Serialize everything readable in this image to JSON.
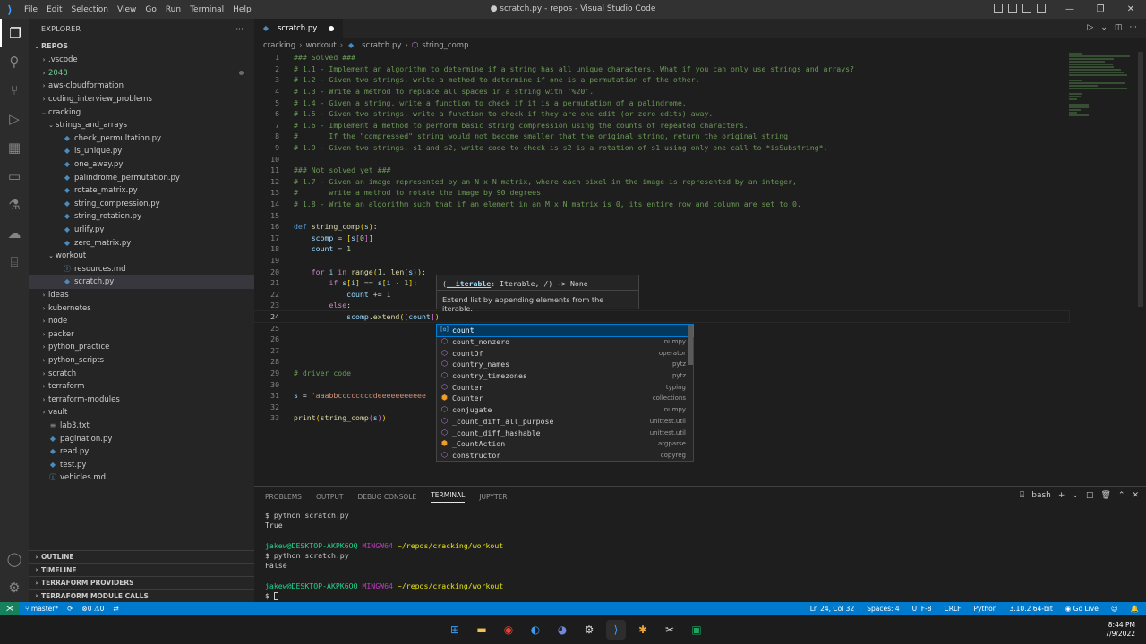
{
  "window": {
    "title": "● scratch.py - repos - Visual Studio Code",
    "menu": [
      "File",
      "Edit",
      "Selection",
      "View",
      "Go",
      "Run",
      "Terminal",
      "Help"
    ]
  },
  "sidebar": {
    "header": "EXPLORER",
    "header_more": "···",
    "root": "REPOS",
    "tree": [
      {
        "label": ".vscode",
        "depth": 1,
        "type": "folder",
        "open": false
      },
      {
        "label": "2048",
        "depth": 1,
        "type": "folder",
        "open": false,
        "color": "#73c991",
        "modified": true
      },
      {
        "label": "aws-cloudformation",
        "depth": 1,
        "type": "folder",
        "open": false
      },
      {
        "label": "coding_interview_problems",
        "depth": 1,
        "type": "folder",
        "open": false
      },
      {
        "label": "cracking",
        "depth": 1,
        "type": "folder",
        "open": true
      },
      {
        "label": "strings_and_arrays",
        "depth": 2,
        "type": "folder",
        "open": true
      },
      {
        "label": "check_permultation.py",
        "depth": 3,
        "type": "py"
      },
      {
        "label": "is_unique.py",
        "depth": 3,
        "type": "py"
      },
      {
        "label": "one_away.py",
        "depth": 3,
        "type": "py"
      },
      {
        "label": "palindrome_permutation.py",
        "depth": 3,
        "type": "py"
      },
      {
        "label": "rotate_matrix.py",
        "depth": 3,
        "type": "py"
      },
      {
        "label": "string_compression.py",
        "depth": 3,
        "type": "py"
      },
      {
        "label": "string_rotation.py",
        "depth": 3,
        "type": "py"
      },
      {
        "label": "urlify.py",
        "depth": 3,
        "type": "py"
      },
      {
        "label": "zero_matrix.py",
        "depth": 3,
        "type": "py"
      },
      {
        "label": "workout",
        "depth": 2,
        "type": "folder",
        "open": true
      },
      {
        "label": "resources.md",
        "depth": 3,
        "type": "md"
      },
      {
        "label": "scratch.py",
        "depth": 3,
        "type": "py",
        "selected": true
      },
      {
        "label": "ideas",
        "depth": 1,
        "type": "folder",
        "open": false
      },
      {
        "label": "kubernetes",
        "depth": 1,
        "type": "folder",
        "open": false
      },
      {
        "label": "node",
        "depth": 1,
        "type": "folder",
        "open": false
      },
      {
        "label": "packer",
        "depth": 1,
        "type": "folder",
        "open": false
      },
      {
        "label": "python_practice",
        "depth": 1,
        "type": "folder",
        "open": false
      },
      {
        "label": "python_scripts",
        "depth": 1,
        "type": "folder",
        "open": false
      },
      {
        "label": "scratch",
        "depth": 1,
        "type": "folder",
        "open": false
      },
      {
        "label": "terraform",
        "depth": 1,
        "type": "folder",
        "open": false
      },
      {
        "label": "terraform-modules",
        "depth": 1,
        "type": "folder",
        "open": false
      },
      {
        "label": "vault",
        "depth": 1,
        "type": "folder",
        "open": false
      },
      {
        "label": "lab3.txt",
        "depth": 1,
        "type": "txt"
      },
      {
        "label": "pagination.py",
        "depth": 1,
        "type": "py"
      },
      {
        "label": "read.py",
        "depth": 1,
        "type": "py"
      },
      {
        "label": "test.py",
        "depth": 1,
        "type": "py"
      },
      {
        "label": "vehicles.md",
        "depth": 1,
        "type": "md"
      }
    ],
    "sections": [
      "OUTLINE",
      "TIMELINE",
      "TERRAFORM PROVIDERS",
      "TERRAFORM MODULE CALLS"
    ]
  },
  "editor": {
    "tab_label": "scratch.py",
    "breadcrumb": [
      "cracking",
      "workout",
      "scratch.py",
      "string_comp"
    ],
    "current_line": 24,
    "lines": [
      {
        "n": 1,
        "t": [
          [
            "cm",
            "### Solved ###"
          ]
        ]
      },
      {
        "n": 2,
        "t": [
          [
            "cm",
            "# 1.1 - Implement an algorithm to determine if a string has all unique characters. What if you can only use strings and arrays?"
          ]
        ]
      },
      {
        "n": 3,
        "t": [
          [
            "cm",
            "# 1.2 - Given two strings, write a method to determine if one is a permutation of the other."
          ]
        ]
      },
      {
        "n": 4,
        "t": [
          [
            "cm",
            "# 1.3 - Write a method to replace all spaces in a string with '%20'."
          ]
        ]
      },
      {
        "n": 5,
        "t": [
          [
            "cm",
            "# 1.4 - Given a string, write a function to check if it is a permutation of a palindrome."
          ]
        ]
      },
      {
        "n": 6,
        "t": [
          [
            "cm",
            "# 1.5 - Given two strings, write a function to check if they are one edit (or zero edits) away."
          ]
        ]
      },
      {
        "n": 7,
        "t": [
          [
            "cm",
            "# 1.6 - Implement a method to perform basic string compression using the counts of repeated characters."
          ]
        ]
      },
      {
        "n": 8,
        "t": [
          [
            "cm",
            "#       If the \"compressed\" string would not become smaller that the original string, return the original string"
          ]
        ]
      },
      {
        "n": 9,
        "t": [
          [
            "cm",
            "# 1.9 - Given two strings, s1 and s2, write code to check is s2 is a rotation of s1 using only one call to *isSubstring*."
          ]
        ]
      },
      {
        "n": 10,
        "t": []
      },
      {
        "n": 11,
        "t": [
          [
            "cm",
            "### Not solved yet ###"
          ]
        ]
      },
      {
        "n": 12,
        "t": [
          [
            "cm",
            "# 1.7 - Given an image represented by an N x N matrix, where each pixel in the image is represented by an integer,"
          ]
        ]
      },
      {
        "n": 13,
        "t": [
          [
            "cm",
            "#       write a method to rotate the image by 90 degrees."
          ]
        ]
      },
      {
        "n": 14,
        "t": [
          [
            "cm",
            "# 1.8 - Write an algorithm such that if an element in an M x N matrix is 0, its entire row and column are set to 0."
          ]
        ]
      },
      {
        "n": 15,
        "t": []
      },
      {
        "n": 16,
        "t": [
          [
            "kw",
            "def "
          ],
          [
            "fn",
            "string_comp"
          ],
          [
            "br1",
            "("
          ],
          [
            "vr",
            "s"
          ],
          [
            "br1",
            ")"
          ],
          [
            "op",
            ":"
          ]
        ]
      },
      {
        "n": 17,
        "t": [
          [
            "op",
            "    "
          ],
          [
            "vr",
            "scomp"
          ],
          [
            "op",
            " = "
          ],
          [
            "br1",
            "["
          ],
          [
            "vr",
            "s"
          ],
          [
            "br2",
            "["
          ],
          [
            "nu",
            "0"
          ],
          [
            "br2",
            "]"
          ],
          [
            "br1",
            "]"
          ]
        ]
      },
      {
        "n": 18,
        "t": [
          [
            "op",
            "    "
          ],
          [
            "vr",
            "count"
          ],
          [
            "op",
            " = "
          ],
          [
            "nu",
            "1"
          ]
        ]
      },
      {
        "n": 19,
        "t": []
      },
      {
        "n": 20,
        "t": [
          [
            "op",
            "    "
          ],
          [
            "kc",
            "for "
          ],
          [
            "vr",
            "i"
          ],
          [
            "kc",
            " in "
          ],
          [
            "fn",
            "range"
          ],
          [
            "br1",
            "("
          ],
          [
            "nu",
            "1"
          ],
          [
            "op",
            ", "
          ],
          [
            "fn",
            "len"
          ],
          [
            "br2",
            "("
          ],
          [
            "vr",
            "s"
          ],
          [
            "br2",
            ")"
          ],
          [
            "br1",
            ")"
          ],
          [
            "op",
            ":"
          ]
        ]
      },
      {
        "n": 21,
        "t": [
          [
            "op",
            "        "
          ],
          [
            "kc",
            "if "
          ],
          [
            "vr",
            "s"
          ],
          [
            "br1",
            "["
          ],
          [
            "vr",
            "i"
          ],
          [
            "br1",
            "]"
          ],
          [
            "op",
            " == "
          ],
          [
            "vr",
            "s"
          ],
          [
            "br1",
            "["
          ],
          [
            "vr",
            "i"
          ],
          [
            "op",
            " - "
          ],
          [
            "nu",
            "1"
          ],
          [
            "br1",
            "]"
          ],
          [
            "op",
            ":"
          ]
        ]
      },
      {
        "n": 22,
        "t": [
          [
            "op",
            "            "
          ],
          [
            "vr",
            "count"
          ],
          [
            "op",
            " += "
          ],
          [
            "nu",
            "1"
          ]
        ]
      },
      {
        "n": 23,
        "t": [
          [
            "op",
            "        "
          ],
          [
            "kc",
            "else"
          ],
          [
            "op",
            ":"
          ]
        ]
      },
      {
        "n": 24,
        "t": [
          [
            "op",
            "            "
          ],
          [
            "vr",
            "scomp"
          ],
          [
            "op",
            "."
          ],
          [
            "fn",
            "extend"
          ],
          [
            "br1",
            "("
          ],
          [
            "br2",
            "["
          ],
          [
            "vr",
            "count"
          ],
          [
            "br2",
            "]"
          ],
          [
            "br1",
            ")"
          ]
        ]
      },
      {
        "n": 25,
        "t": []
      },
      {
        "n": 26,
        "t": []
      },
      {
        "n": 27,
        "t": []
      },
      {
        "n": 28,
        "t": []
      },
      {
        "n": 29,
        "t": [
          [
            "cm",
            "# driver code"
          ]
        ]
      },
      {
        "n": 30,
        "t": []
      },
      {
        "n": 31,
        "t": [
          [
            "vr",
            "s"
          ],
          [
            "op",
            " = "
          ],
          [
            "st",
            "'aaabbcccccccddeeeeeeeeeee"
          ]
        ]
      },
      {
        "n": 32,
        "t": []
      },
      {
        "n": 33,
        "t": [
          [
            "fn",
            "print"
          ],
          [
            "br1",
            "("
          ],
          [
            "fn",
            "string_comp"
          ],
          [
            "br2",
            "("
          ],
          [
            "vr",
            "s"
          ],
          [
            "br2",
            ")"
          ],
          [
            "br1",
            ")"
          ]
        ]
      }
    ]
  },
  "hover": {
    "signature": "(__iterable: Iterable, /) -> None",
    "param": "__iterable",
    "doc": "Extend list by appending elements from the iterable."
  },
  "suggestions": [
    {
      "label": "count",
      "detail": "",
      "kind": "var",
      "selected": true
    },
    {
      "label": "count_nonzero",
      "detail": "numpy",
      "kind": "mod"
    },
    {
      "label": "countOf",
      "detail": "operator",
      "kind": "mod"
    },
    {
      "label": "country_names",
      "detail": "pytz",
      "kind": "mod"
    },
    {
      "label": "country_timezones",
      "detail": "pytz",
      "kind": "mod"
    },
    {
      "label": "Counter",
      "detail": "typing",
      "kind": "mod"
    },
    {
      "label": "Counter",
      "detail": "collections",
      "kind": "cls"
    },
    {
      "label": "conjugate",
      "detail": "numpy",
      "kind": "mod"
    },
    {
      "label": "_count_diff_all_purpose",
      "detail": "unittest.util",
      "kind": "mod"
    },
    {
      "label": "_count_diff_hashable",
      "detail": "unittest.util",
      "kind": "mod"
    },
    {
      "label": "_CountAction",
      "detail": "argparse",
      "kind": "cls"
    },
    {
      "label": "constructor",
      "detail": "copyreg",
      "kind": "mod"
    }
  ],
  "panel": {
    "tabs": [
      "PROBLEMS",
      "OUTPUT",
      "DEBUG CONSOLE",
      "TERMINAL",
      "JUPYTER"
    ],
    "active_tab": "TERMINAL",
    "shell": "bash",
    "terminal": [
      {
        "kind": "cmd",
        "text": "$ python scratch.py"
      },
      {
        "kind": "out",
        "text": "True"
      },
      {
        "kind": "blank",
        "text": ""
      },
      {
        "kind": "prompt",
        "user": "jakew@DESKTOP-AKPK6OQ",
        "env": "MINGW64",
        "path": "~/repos/cracking/workout"
      },
      {
        "kind": "cmd",
        "text": "$ python scratch.py"
      },
      {
        "kind": "out",
        "text": "False"
      },
      {
        "kind": "blank",
        "text": ""
      },
      {
        "kind": "prompt",
        "user": "jakew@DESKTOP-AKPK6OQ",
        "env": "MINGW64",
        "path": "~/repos/cracking/workout"
      },
      {
        "kind": "cursor",
        "text": "$ "
      }
    ]
  },
  "statusbar": {
    "branch": "master*",
    "errors": "0",
    "warnings": "0",
    "position": "Ln 24, Col 32",
    "spaces": "Spaces: 4",
    "encoding": "UTF-8",
    "eol": "CRLF",
    "language": "Python",
    "interpreter": "3.10.2 64-bit",
    "golive": "Go Live"
  },
  "taskbar": {
    "time": "8:44 PM",
    "date": "7/9/2022"
  },
  "colors": {
    "accent": "#007acc",
    "remote": "#16825d"
  }
}
